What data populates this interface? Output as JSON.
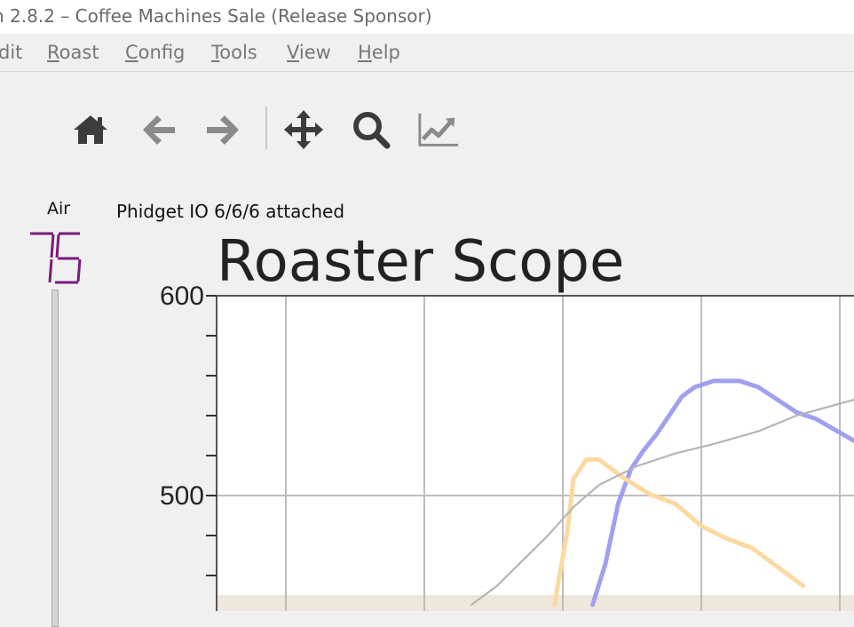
{
  "window": {
    "title": "n 2.8.2 – Coffee Machines Sale (Release Sponsor)"
  },
  "menu": [
    {
      "label_u": "",
      "label_rest": "dit"
    },
    {
      "label_u": "R",
      "label_rest": "oast"
    },
    {
      "label_u": "C",
      "label_rest": "onfig"
    },
    {
      "label_u": "T",
      "label_rest": "ools"
    },
    {
      "label_u": "V",
      "label_rest": "iew"
    },
    {
      "label_u": "H",
      "label_rest": "elp"
    }
  ],
  "toolbar": {
    "icons": [
      "home-icon",
      "back-arrow-icon",
      "forward-arrow-icon",
      "move-icon",
      "zoom-icon",
      "line-chart-icon"
    ]
  },
  "sidebar": {
    "air_label": "Air",
    "air_value": "75"
  },
  "status": {
    "text": "Phidget IO 6/6/6 attached"
  },
  "colors": {
    "lcd": "#7a1a7a",
    "bt_curve": "#a0a0f0",
    "et_curve": "#fcd9a0",
    "bg_curve": "#b5b5b5"
  },
  "chart_data": {
    "type": "line",
    "title": "Roaster Scope",
    "y_tick_labels": [
      "600",
      "500"
    ],
    "ylim": [
      450,
      600
    ],
    "grid": true,
    "series": [
      {
        "points": [
          [
            0.59,
            0.98
          ],
          [
            0.61,
            0.85
          ],
          [
            0.63,
            0.66
          ],
          [
            0.65,
            0.55
          ],
          [
            0.67,
            0.49
          ],
          [
            0.69,
            0.44
          ],
          [
            0.71,
            0.38
          ],
          [
            0.73,
            0.32
          ],
          [
            0.75,
            0.29
          ],
          [
            0.78,
            0.27
          ],
          [
            0.8,
            0.27
          ],
          [
            0.82,
            0.27
          ],
          [
            0.85,
            0.29
          ],
          [
            0.88,
            0.33
          ],
          [
            0.91,
            0.37
          ],
          [
            0.94,
            0.39
          ],
          [
            1.0,
            0.46
          ]
        ]
      },
      {
        "points": [
          [
            0.53,
            0.98
          ],
          [
            0.55,
            0.75
          ],
          [
            0.56,
            0.58
          ],
          [
            0.58,
            0.52
          ],
          [
            0.6,
            0.52
          ],
          [
            0.64,
            0.58
          ],
          [
            0.68,
            0.63
          ],
          [
            0.72,
            0.66
          ],
          [
            0.76,
            0.73
          ],
          [
            0.8,
            0.77
          ],
          [
            0.84,
            0.8
          ],
          [
            0.88,
            0.86
          ],
          [
            0.92,
            0.92
          ]
        ]
      },
      {
        "points": [
          [
            0.4,
            0.98
          ],
          [
            0.44,
            0.92
          ],
          [
            0.48,
            0.84
          ],
          [
            0.52,
            0.76
          ],
          [
            0.56,
            0.67
          ],
          [
            0.6,
            0.6
          ],
          [
            0.66,
            0.54
          ],
          [
            0.72,
            0.5
          ],
          [
            0.78,
            0.47
          ],
          [
            0.85,
            0.43
          ],
          [
            0.91,
            0.38
          ],
          [
            1.0,
            0.33
          ]
        ]
      }
    ]
  }
}
